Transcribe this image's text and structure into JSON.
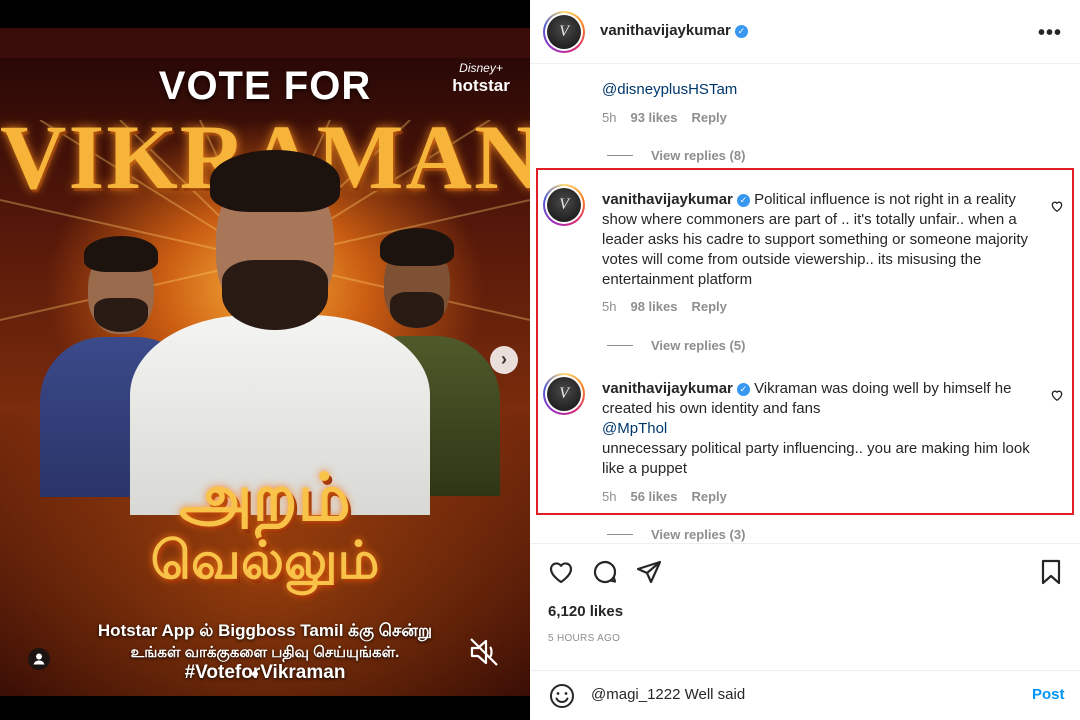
{
  "media": {
    "brand_top": "Disney+",
    "brand_bottom": "hotstar",
    "headline": "VOTE FOR",
    "name": "VIKRAMAN",
    "tamil_line1": "அறம்",
    "tamil_line2": "வெல்லும்",
    "caption_line1": "Hotstar App ல் Biggboss Tamil க்கு சென்று",
    "caption_line2": "உங்கள் வாக்குகளை பதிவு செய்யுங்கள்.",
    "hashtag": "#VoteforVikraman",
    "next_icon": "chevron-right-icon",
    "tag_icon": "user-tag-icon",
    "mute_icon": "speaker-muted-icon"
  },
  "header": {
    "username": "vanithavijaykumar",
    "avatar_text": "V",
    "more_icon": "more-horizontal-icon"
  },
  "comments": [
    {
      "text": "@disneyplusHSTam",
      "time": "5h",
      "likes": "93 likes",
      "reply": "Reply",
      "view_replies": "View replies (8)"
    },
    {
      "username": "vanithavijaykumar",
      "text": "Political influence is not right in a reality show where commoners are part of .. it's totally unfair.. when a leader asks his cadre to support something or someone majority votes will come from outside viewership.. its misusing the entertainment platform",
      "time": "5h",
      "likes": "98 likes",
      "reply": "Reply",
      "view_replies": "View replies (5)"
    },
    {
      "username": "vanithavijaykumar",
      "text_part1": "Vikraman was doing well by himself he created his own identity and fans",
      "mention": "@MpThol",
      "text_part2": "unnecessary political party influencing.. you are making him look like a puppet",
      "time": "5h",
      "likes": "56 likes",
      "reply": "Reply",
      "view_replies": "View replies (3)"
    }
  ],
  "actions": {
    "like_icon": "heart-icon",
    "comment_icon": "comment-icon",
    "share_icon": "send-icon",
    "save_icon": "bookmark-icon",
    "likes_count": "6,120 likes",
    "time_ago": "5 HOURS AGO"
  },
  "compose": {
    "emoji_icon": "emoji-icon",
    "text": "@magi_1222 Well said",
    "post_label": "Post"
  },
  "colors": {
    "highlight_border": "#e01e24",
    "link": "#00376b",
    "post_button": "#0095f6",
    "verified": "#3897f0"
  }
}
